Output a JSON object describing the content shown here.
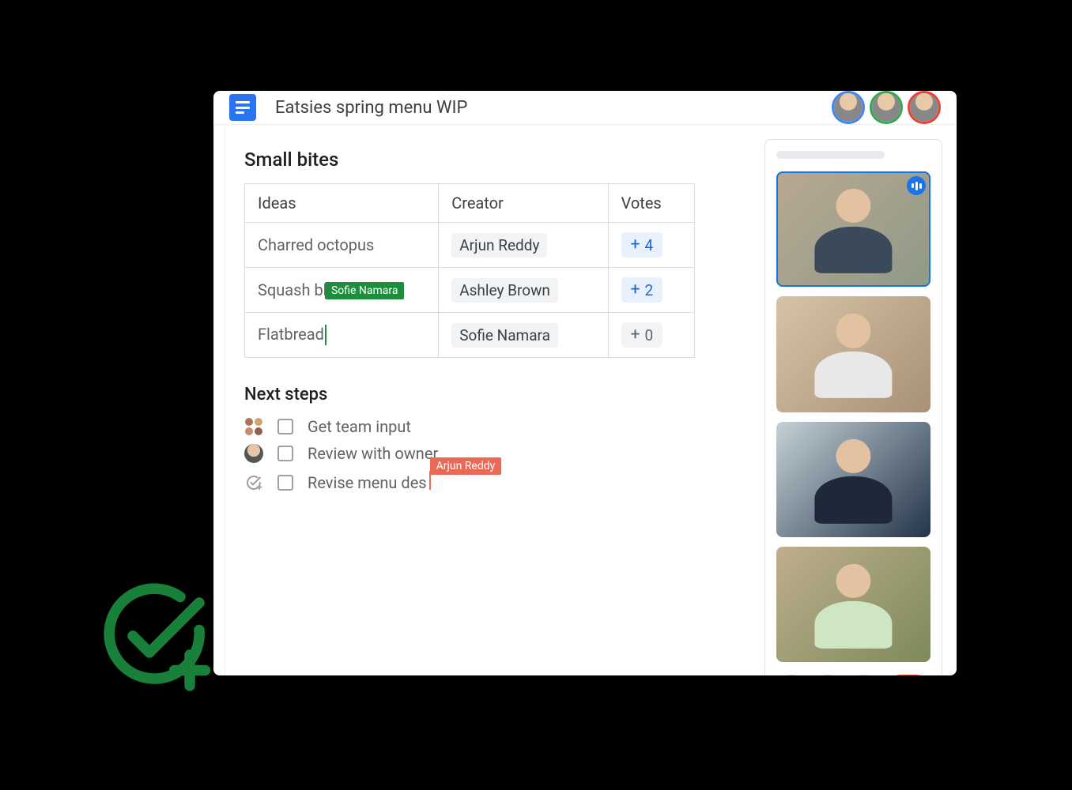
{
  "header": {
    "doc_title": "Eatsies spring menu WIP"
  },
  "collaborator_avatars": [
    {
      "name": "collaborator-1",
      "ring_color": "#4285f4"
    },
    {
      "name": "collaborator-2",
      "ring_color": "#34a853"
    },
    {
      "name": "collaborator-3",
      "ring_color": "#ea4335"
    }
  ],
  "sections": {
    "small_bites": {
      "heading": "Small bites",
      "columns": {
        "ideas": "Ideas",
        "creator": "Creator",
        "votes": "Votes"
      },
      "rows": [
        {
          "idea": "Charred octopus",
          "creator": "Arjun Reddy",
          "votes": 4,
          "active": true
        },
        {
          "idea": "Squash blossoms",
          "creator": "Ashley Brown",
          "votes": 2,
          "active": true
        },
        {
          "idea": "Flatbread",
          "creator": "Sofie Namara",
          "votes": 0,
          "active": false,
          "editing_cursor": {
            "user": "Sofie Namara",
            "color": "#1e8e3e"
          }
        }
      ]
    },
    "next_steps": {
      "heading": "Next steps",
      "items": [
        {
          "icon": "team",
          "text": "Get team input",
          "checked": false
        },
        {
          "icon": "owner",
          "text": "Review with owner",
          "checked": false
        },
        {
          "icon": "revise",
          "text": "Revise menu des",
          "checked": false,
          "editing_cursor": {
            "user": "Arjun Reddy",
            "color": "#ea6a57"
          }
        }
      ]
    }
  },
  "meet_panel": {
    "tiles": [
      {
        "name": "participant-1",
        "speaking": true
      },
      {
        "name": "participant-2",
        "speaking": false
      },
      {
        "name": "participant-3",
        "speaking": false
      },
      {
        "name": "participant-4",
        "speaking": false
      }
    ],
    "controls": {
      "mic": "microphone-icon",
      "camera": "video-icon",
      "more": "more-options-icon",
      "hangup": "hang-up-icon"
    }
  },
  "vote_symbol": "+"
}
